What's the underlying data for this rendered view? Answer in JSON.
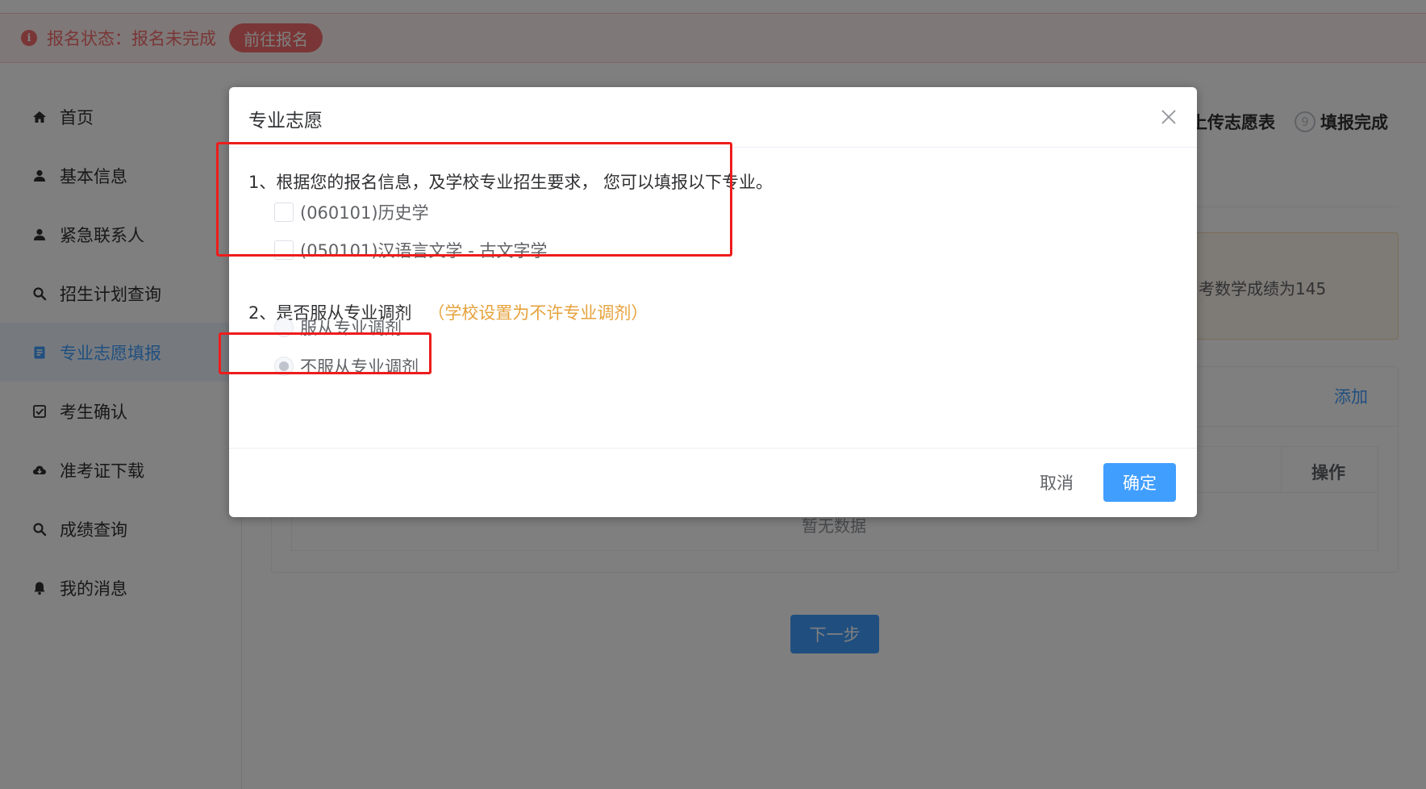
{
  "alert": {
    "icon": "info-icon",
    "status_text": "报名状态：报名未完成",
    "action_label": "前往报名"
  },
  "sidebar": {
    "items": [
      {
        "label": "首页",
        "icon": "home-icon"
      },
      {
        "label": "基本信息",
        "icon": "user-icon"
      },
      {
        "label": "紧急联系人",
        "icon": "user-icon"
      },
      {
        "label": "招生计划查询",
        "icon": "search-icon"
      },
      {
        "label": "专业志愿填报",
        "icon": "document-icon",
        "active": true
      },
      {
        "label": "考生确认",
        "icon": "checkbox-icon"
      },
      {
        "label": "准考证下载",
        "icon": "cloud-download-icon"
      },
      {
        "label": "成绩查询",
        "icon": "search-icon"
      },
      {
        "label": "我的消息",
        "icon": "bell-icon"
      }
    ]
  },
  "steps": {
    "step8_label": "上传志愿表",
    "step9_number": "9",
    "step9_label": "填报完成"
  },
  "background": {
    "warning_text": "考数学成绩为145",
    "add_label": "添加",
    "table_op_header": "操作",
    "empty_text": "暂无数据",
    "next_label": "下一步"
  },
  "dialog": {
    "title": "专业志愿",
    "question1": "1、根据您的报名信息，及学校专业招生要求， 您可以填报以下专业。",
    "majors": [
      {
        "label": "(060101)历史学",
        "checked": false
      },
      {
        "label": "(050101)汉语言文学 - 古文字学",
        "checked": false
      }
    ],
    "question2": "2、是否服从专业调剂",
    "question2_note": "（学校设置为不许专业调剂）",
    "adjust_options": [
      {
        "label": "服从专业调剂",
        "selected": false,
        "disabled": true
      },
      {
        "label": "不服从专业调剂",
        "selected": true,
        "disabled": true
      }
    ],
    "cancel_label": "取消",
    "confirm_label": "确定"
  },
  "colors": {
    "primary": "#409eff",
    "danger": "#f56c6c",
    "warning": "#e6a23c",
    "annotation_red": "#ee1c1c"
  }
}
